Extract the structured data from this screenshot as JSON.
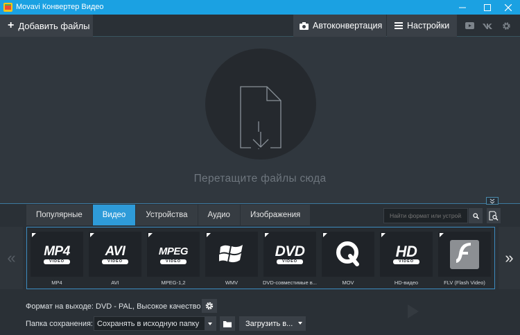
{
  "window": {
    "title": "Movavi Конвертер Видео"
  },
  "toolbar": {
    "add_files": "Добавить файлы",
    "auto_convert": "Автоконвертация",
    "settings": "Настройки"
  },
  "drop_area": {
    "text": "Перетащите файлы сюда"
  },
  "tabs": [
    {
      "label": "Популярные",
      "active": false
    },
    {
      "label": "Видео",
      "active": true
    },
    {
      "label": "Устройства",
      "active": false
    },
    {
      "label": "Аудио",
      "active": false
    },
    {
      "label": "Изображения",
      "active": false
    }
  ],
  "search": {
    "placeholder": "Найти формат или устрой..."
  },
  "formats": [
    {
      "label": "MP4",
      "logo": "MP4",
      "sub": "VIDEO"
    },
    {
      "label": "AVI",
      "logo": "AVI",
      "sub": "VIDEO"
    },
    {
      "label": "MPEG-1,2",
      "logo": "MPEG",
      "sub": "VIDEO"
    },
    {
      "label": "WMV",
      "icon": "windows-logo-icon"
    },
    {
      "label": "DVD-совместимые в...",
      "logo": "DVD",
      "sub": "VIDEO"
    },
    {
      "label": "MOV",
      "icon": "quicktime-logo-icon"
    },
    {
      "label": "HD-видео",
      "logo": "HD",
      "sub": "VIDEO"
    },
    {
      "label": "FLV (Flash Video)",
      "icon": "flash-logo-icon"
    }
  ],
  "output": {
    "format_label": "Формат на выходе:",
    "format_value": "DVD - PAL, Высокое качество",
    "save_label": "Папка сохранения:",
    "save_value": "Сохранять в исходную папку",
    "upload_label": "Загрузить в..."
  },
  "colors": {
    "accent": "#1ba1e2",
    "tab_active": "#2e9bd9"
  }
}
